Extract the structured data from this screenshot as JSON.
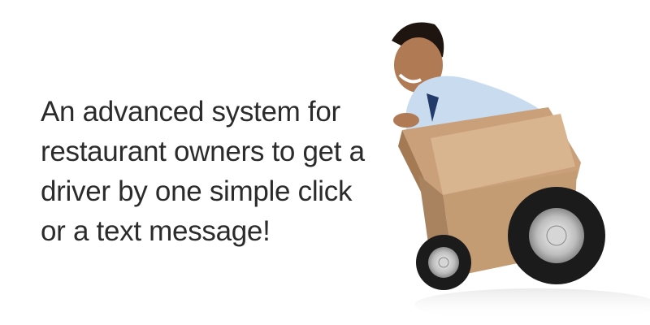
{
  "headline": {
    "lines": [
      "An advanced system for",
      "restaurant owners to get a",
      "driver by one simple click",
      "or a text message!"
    ]
  }
}
